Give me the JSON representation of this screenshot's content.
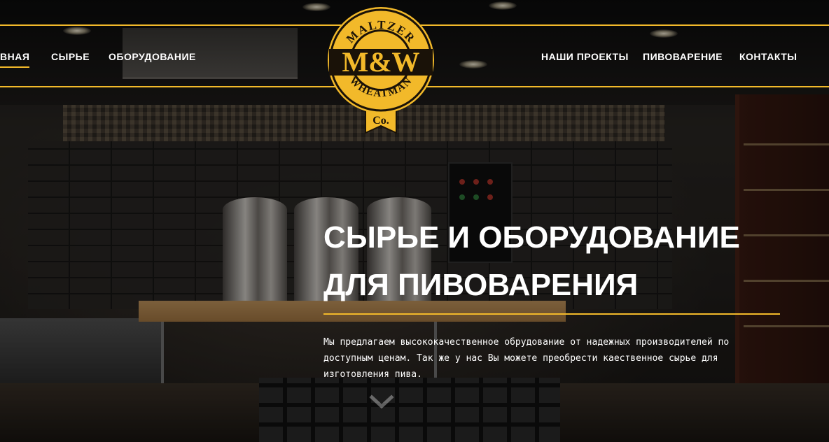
{
  "brand": {
    "logo_top_text": "MALTZER",
    "logo_monogram": "M&W",
    "logo_bottom_text": "WHEATMAN",
    "logo_co": "Co.",
    "accent_color": "#f2b92a",
    "logo_fill": "#f2b92a",
    "logo_dark": "#1a1208"
  },
  "nav": {
    "left": [
      {
        "label": "ВНАЯ",
        "active": true
      },
      {
        "label": "СЫРЬЕ",
        "active": false
      },
      {
        "label": "ОБОРУДОВАНИЕ",
        "active": false
      }
    ],
    "right": [
      {
        "label": "НАШИ ПРОЕКТЫ"
      },
      {
        "label": "ПИВОВАРЕНИЕ"
      },
      {
        "label": "КОНТАКТЫ"
      }
    ]
  },
  "hero": {
    "title_line1": "СЫРЬЕ И ОБОРУДОВАНИЕ",
    "title_line2": "ДЛЯ ПИВОВАРЕНИЯ",
    "description": "Мы предлагаем высококачественное обрудование от надежных производителей по доступным ценам. Так же у нас Вы можете преобрести каественное сырье для изготовления пива.",
    "scroll_icon": "chevron-down-icon"
  }
}
